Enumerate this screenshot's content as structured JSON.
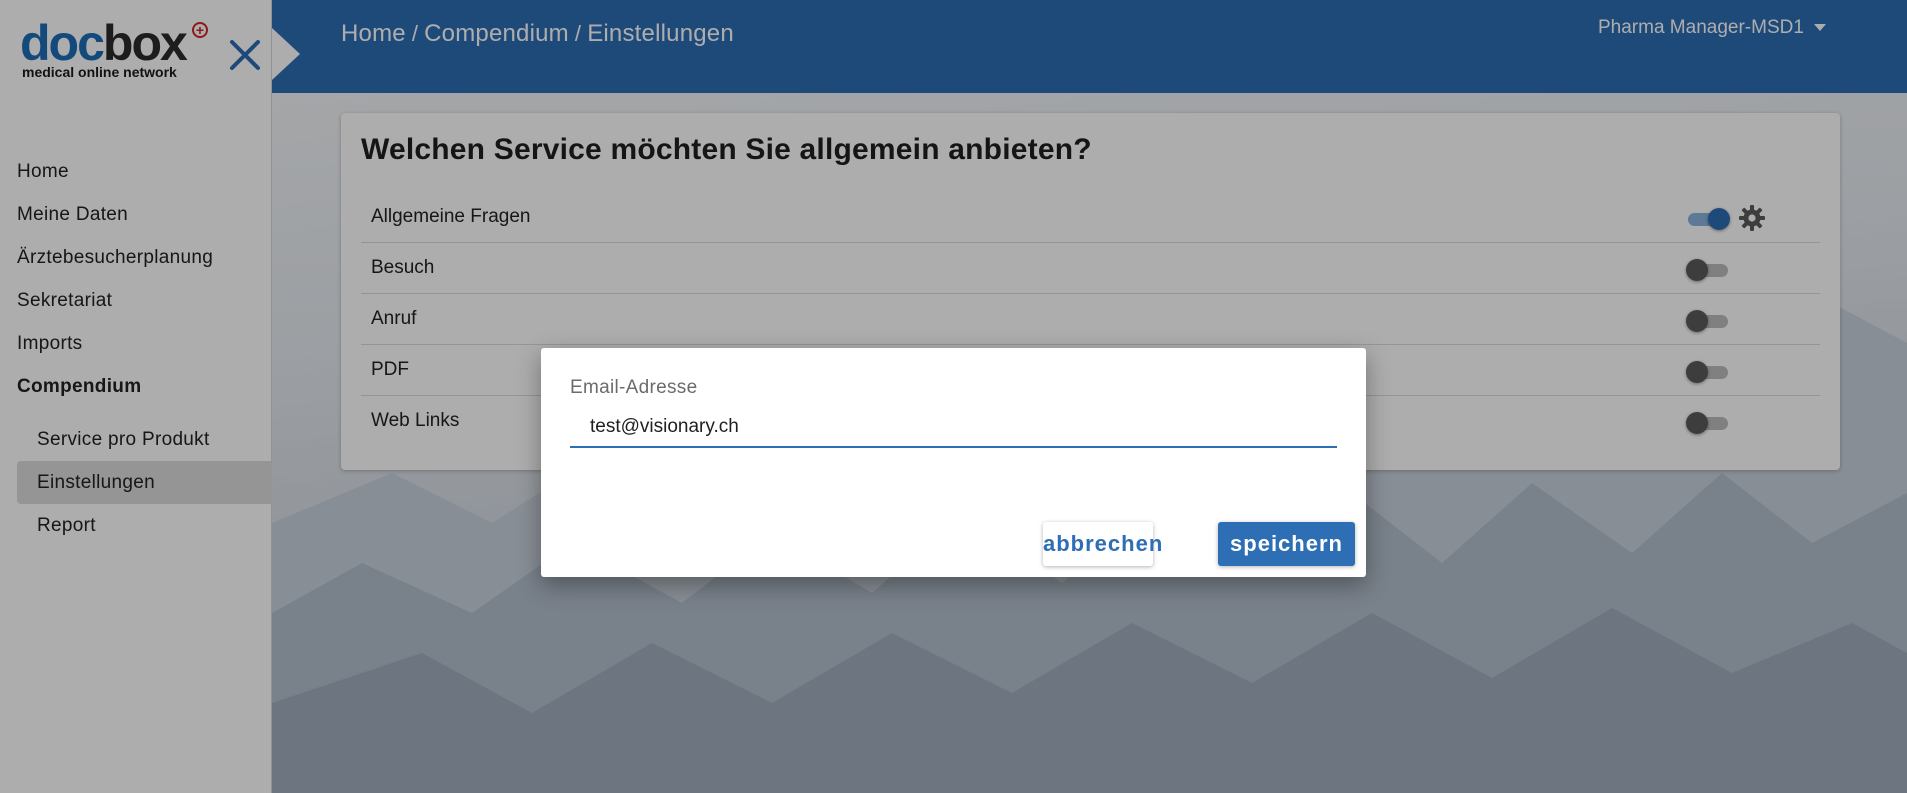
{
  "logo": {
    "brand_part1": "doc",
    "brand_part2": "box",
    "tagline": "medical online network",
    "brand_colors": {
      "doc": "#1d6db5",
      "box": "#2b2b2b",
      "plus": "#d0242b"
    }
  },
  "header": {
    "background": "#2d6eb4",
    "breadcrumb": [
      "Home",
      "Compendium",
      "Einstellungen"
    ],
    "breadcrumb_separator": "/",
    "user_menu": "Pharma Manager-MSD1"
  },
  "sidebar": {
    "items": [
      {
        "label": "Home"
      },
      {
        "label": "Meine Daten"
      },
      {
        "label": "Ärztebesucherplanung"
      },
      {
        "label": "Sekretariat"
      },
      {
        "label": "Imports"
      },
      {
        "label": "Compendium"
      }
    ],
    "subitems": [
      {
        "label": "Service pro Produkt"
      },
      {
        "label": "Einstellungen",
        "active": true
      },
      {
        "label": "Report"
      }
    ]
  },
  "card": {
    "title": "Welchen Service möchten Sie allgemein anbieten?",
    "services": [
      {
        "label": "Allgemeine Fragen",
        "enabled": true
      },
      {
        "label": "Besuch",
        "enabled": false
      },
      {
        "label": "Anruf",
        "enabled": false
      },
      {
        "label": "PDF",
        "enabled": false
      },
      {
        "label": "Web Links",
        "enabled": false
      }
    ]
  },
  "dialog": {
    "field_label": "Email-Adresse",
    "email_value": "test@visionary.ch",
    "cancel_label": "abbrechen",
    "save_label": "speichern"
  },
  "icons": {
    "close": "close-icon",
    "gear": "gear-icon",
    "caret": "chevron-down-icon"
  },
  "colors": {
    "accent": "#2d6eb4",
    "toggle_on_track": "#8ab3dd",
    "toggle_off_thumb": "#5b5b5b"
  }
}
